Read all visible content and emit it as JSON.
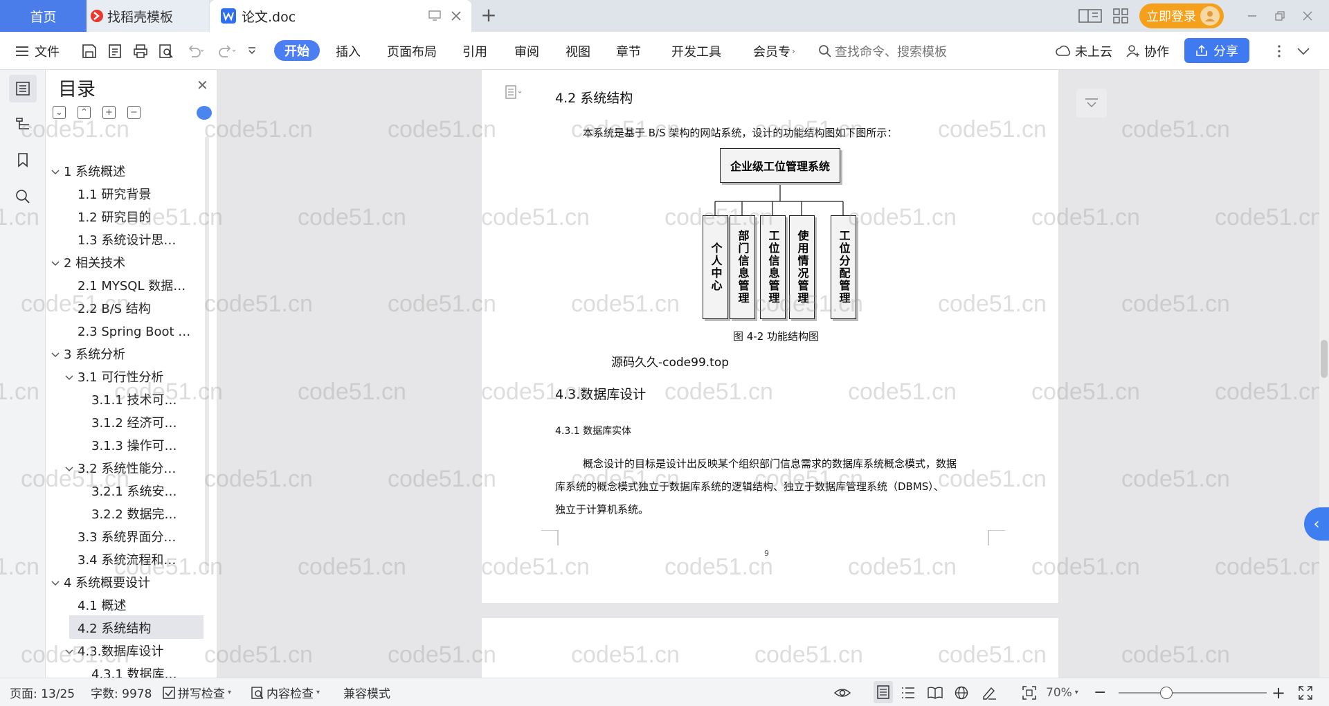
{
  "titlebar": {
    "home_tab": "首页",
    "template_tab": "找稻壳模板",
    "doc_tab": "论文.doc",
    "login_button": "立即登录"
  },
  "ribbon": {
    "file": "文件",
    "tabs": [
      "开始",
      "插入",
      "页面布局",
      "引用",
      "审阅",
      "视图",
      "章节",
      "开发工具",
      "会员专"
    ],
    "search_placeholder": "查找命令、搜索模板",
    "cloud": "未上云",
    "collab": "协作",
    "share": "分享"
  },
  "toc": {
    "title": "目录",
    "items": [
      {
        "text": "1 系统概述",
        "level": 1,
        "caret": "down"
      },
      {
        "text": "1.1  研究背景",
        "level": 2
      },
      {
        "text": "1.2 研究目的",
        "level": 2
      },
      {
        "text": "1.3 系统设计思…",
        "level": 2
      },
      {
        "text": "2 相关技术",
        "level": 1,
        "caret": "down"
      },
      {
        "text": "2.1 MYSQL 数据…",
        "level": 2
      },
      {
        "text": "2.2 B/S 结构",
        "level": 2
      },
      {
        "text": "2.3 Spring Boot …",
        "level": 2
      },
      {
        "text": "3 系统分析",
        "level": 1,
        "caret": "down"
      },
      {
        "text": "3.1 可行性分析",
        "level": 2,
        "caret": "down"
      },
      {
        "text": "3.1.1 技术可…",
        "level": 3
      },
      {
        "text": "3.1.2 经济可…",
        "level": 3
      },
      {
        "text": "3.1.3 操作可…",
        "level": 3
      },
      {
        "text": "3.2 系统性能分…",
        "level": 2,
        "caret": "down"
      },
      {
        "text": "3.2.1  系统安…",
        "level": 3
      },
      {
        "text": "3.2.2  数据完…",
        "level": 3
      },
      {
        "text": "3.3 系统界面分…",
        "level": 2
      },
      {
        "text": "3.4 系统流程和…",
        "level": 2
      },
      {
        "text": "4 系统概要设计",
        "level": 1,
        "caret": "down"
      },
      {
        "text": "4.1 概述",
        "level": 2
      },
      {
        "text": "4.2 系统结构",
        "level": 2,
        "selected": true
      },
      {
        "text": "4.3.数据库设计",
        "level": 2,
        "caret": "down"
      },
      {
        "text": "4.3.1 数据库…",
        "level": 3
      }
    ]
  },
  "document": {
    "heading_42": "4.2 系统结构",
    "intro": "本系统是基于 B/S 架构的网站系统，设计的功能结构图如下图所示：",
    "diagram_root": "企业级工位管理系统",
    "diagram_children": [
      "个人中心",
      "部门信息管理",
      "工位信息管理",
      "使用情况管理",
      "工位分配管理"
    ],
    "caption": "图 4-2 功能结构图",
    "source_line": "源码久久-code99.top",
    "heading_43": "4.3.数据库设计",
    "heading_431": "4.3.1 数据库实体",
    "body_lines": [
      "概念设计的目标是设计出反映某个组织部门信息需求的数据库系统概念模式，数据",
      "库系统的概念模式独立于数据库系统的逻辑结构、独立于数据库管理系统（DBMS）、",
      "独立于计算机系统。"
    ],
    "page_number": "9"
  },
  "watermark": "code51.cn",
  "status": {
    "page": "页面: 13/25",
    "words": "字数: 9978",
    "spell": "拼写检查",
    "content": "内容检查",
    "compat": "兼容模式",
    "zoom": "70%"
  }
}
